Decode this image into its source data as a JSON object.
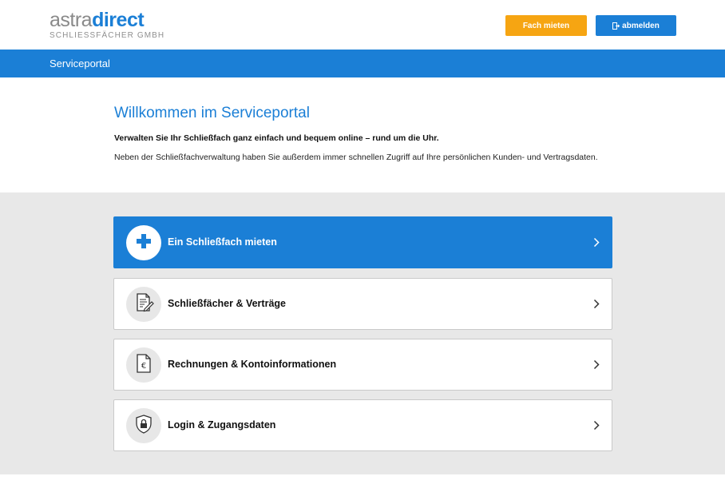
{
  "brand": {
    "logo_part1": "astra",
    "logo_part2": "direct",
    "logo_sub": "SCHLIESSFÄCHER GMBH"
  },
  "header": {
    "rent_button": "Fach mieten",
    "logout_button": "abmelden"
  },
  "nav": {
    "title": "Serviceportal"
  },
  "intro": {
    "heading": "Willkommen im Serviceportal",
    "lead": "Verwalten Sie Ihr Schließfach ganz einfach und bequem online – rund um die Uhr.",
    "body": "Neben der Schließfachverwaltung haben Sie außerdem immer schnellen Zugriff auf Ihre persönlichen Kunden- und Vertragsdaten."
  },
  "cards": [
    {
      "label": "Ein Schließfach mieten",
      "icon": "plus-icon"
    },
    {
      "label": "Schließfächer & Verträge",
      "icon": "document-edit-icon"
    },
    {
      "label": "Rechnungen & Kontoinformationen",
      "icon": "euro-document-icon"
    },
    {
      "label": "Login & Zugangsdaten",
      "icon": "shield-lock-icon"
    }
  ],
  "colors": {
    "brand_blue": "#1b7fd6",
    "accent_orange": "#f6a512",
    "background_grey": "#e8e8e8"
  }
}
